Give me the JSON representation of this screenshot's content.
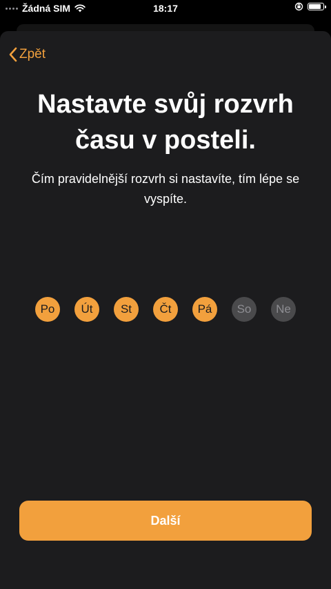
{
  "status_bar": {
    "carrier": "Žádná SIM",
    "time": "18:17",
    "icons": [
      "signal-dots-icon",
      "wifi-icon",
      "orientation-lock-icon",
      "battery-icon"
    ]
  },
  "nav": {
    "back_label": "Zpět"
  },
  "header": {
    "title": "Nastavte svůj rozvrh času v posteli.",
    "subtitle": "Čím pravidelnější rozvrh si nastavíte, tím lépe se vyspíte."
  },
  "days": [
    {
      "label": "Po",
      "selected": true
    },
    {
      "label": "Út",
      "selected": true
    },
    {
      "label": "St",
      "selected": true
    },
    {
      "label": "Čt",
      "selected": true
    },
    {
      "label": "Pá",
      "selected": true
    },
    {
      "label": "So",
      "selected": false
    },
    {
      "label": "Ne",
      "selected": false
    }
  ],
  "footer": {
    "next_label": "Další"
  },
  "colors": {
    "accent": "#f2a03d",
    "sheet_background": "#1c1c1e",
    "day_off": "#4a4a4c"
  }
}
